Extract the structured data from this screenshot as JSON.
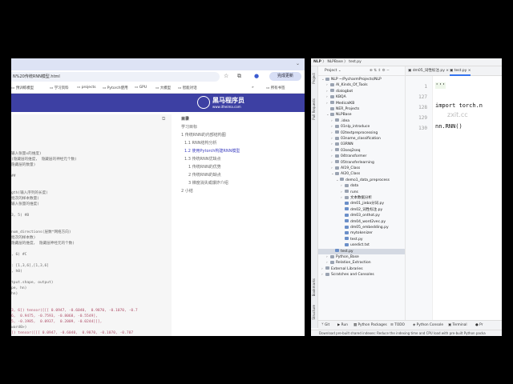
{
  "browser": {
    "url": "N%20传统RNN模型.html",
    "update_label": "完成更新",
    "bookmarks": [
      "预训练模型",
      "学习资料",
      "projects",
      "Pytorch使用",
      "GPU",
      "大模型",
      "智能对话"
    ],
    "all_bookmarks": "所有书签",
    "logo_title": "黑马程序员",
    "logo_sub": "www.itheima.com",
    "code_lines": [
      "输入张量x的维度)",
      "(隐藏层的维度， 隐藏层的神经元个数)",
      "隐藏层的数量)",
      "",
      "##",
      "",
      "",
      "gth(输入序列的长度)",
      "批次的样本数量)",
      "输入张量的维度)",
      "",
      "3, 5) #B",
      "",
      "",
      "num_directions(层数*网络方向)",
      "批次的样本数)",
      "隐藏层的维度， 隐藏层神经元的个数)",
      "",
      ", 6) #C",
      "",
      ": [1,3,6],[1,3,6]",
      ", h0)",
      "",
      "tput.shape, output)",
      "pe, hn)",
      "hn)",
      "",
      "",
      "3, 6]) tensor([[[ 0.0947, -0.6040,  0.9870, -0.1070, -0.7",
      "6,  0.9475, -0.7593, -0.8068, -0.5549],",
      "5, -0.1985,  0.0937,  0.2009, -0.0244]]],",
      "ward0>)",
      "]) tensor([[[ 0.0947, -0.6040,  0.9870, -0.1070, -0.707"
    ],
    "toc": {
      "title": "目录",
      "items": [
        "学习目标",
        "1 传统RNN的内部结构图",
        "1.1 RNN结构分析",
        "1.2 使用Pytorch构建RNN模型",
        "1.3 传统RNN优缺点",
        "1 传统RNN的优势",
        "2 传统RNN的缺点",
        "3 梯度消失或爆炸介绍",
        "2 小结"
      ]
    }
  },
  "ide": {
    "breadcrumb": [
      "NLP",
      "NLPBase",
      "test.py"
    ],
    "project_label": "Project",
    "tree": [
      {
        "label": "NLP ~/PycharmProjects/NLP",
        "d": 0,
        "open": true
      },
      {
        "label": "AI_Kinds_Of_Tools",
        "d": 1
      },
      {
        "label": "dialogbot",
        "d": 1
      },
      {
        "label": "KBQA",
        "d": 1
      },
      {
        "label": "MedicalKB",
        "d": 1
      },
      {
        "label": "NER_Projects",
        "d": 1,
        "noarrow": true
      },
      {
        "label": "NLPBase",
        "d": 1,
        "open": true
      },
      {
        "label": ".idea",
        "d": 2
      },
      {
        "label": "01nlp_introduce",
        "d": 2
      },
      {
        "label": "02textpreprocessing",
        "d": 2
      },
      {
        "label": "03name_classification",
        "d": 2
      },
      {
        "label": "03RNN",
        "d": 2
      },
      {
        "label": "03seq2seq",
        "d": 2
      },
      {
        "label": "04transformer",
        "d": 2
      },
      {
        "label": "05transferlearning",
        "d": 2
      },
      {
        "label": "AI19_Class",
        "d": 2
      },
      {
        "label": "AI20_Class",
        "d": 2,
        "open": true
      },
      {
        "label": "demo1_data_preprocess",
        "d": 3,
        "open": true
      },
      {
        "label": "data",
        "d": 4
      },
      {
        "label": "runs",
        "d": 4
      },
      {
        "label": "文本数据分析",
        "d": 4
      },
      {
        "label": "dm01_jieba分词.py",
        "d": 4,
        "file": true
      },
      {
        "label": "dm02_词性标注.py",
        "d": 4,
        "file": true
      },
      {
        "label": "dm03_onthot.py",
        "d": 4,
        "file": true
      },
      {
        "label": "dm04_word2vec.py",
        "d": 4,
        "file": true
      },
      {
        "label": "dm05_embedding.py",
        "d": 4,
        "file": true
      },
      {
        "label": "mytokenizer",
        "d": 4,
        "file": true
      },
      {
        "label": "test.py",
        "d": 4,
        "file": true
      },
      {
        "label": "usedict.txt",
        "d": 4,
        "file": true
      },
      {
        "label": "test.py",
        "d": 2,
        "file": true,
        "sel": true
      },
      {
        "label": "Python_Base",
        "d": 1
      },
      {
        "label": "Relation_Extraction",
        "d": 1
      },
      {
        "label": "External Libraries",
        "d": 0
      },
      {
        "label": "Scratches and Consoles",
        "d": 0
      }
    ],
    "tabs": [
      "dm05_词性标注.py",
      "test.py"
    ],
    "line_numbers": [
      "1",
      "127",
      "128",
      "129",
      "130"
    ],
    "code": [
      "'''",
      "import torch.n",
      "nn.RNN()"
    ],
    "watermark": "zxit.cc",
    "bottom_tools": [
      "Git",
      "Run",
      "Python Packages",
      "TODO",
      "Python Console",
      "Terminal",
      "Pr"
    ],
    "side_tools": [
      "Project",
      "Pull Requests",
      "Bookmarks",
      "Structure"
    ],
    "status": "Download pre-built shared indexes: Reduce the indexing time and CPU load with pre-built Python packa"
  }
}
